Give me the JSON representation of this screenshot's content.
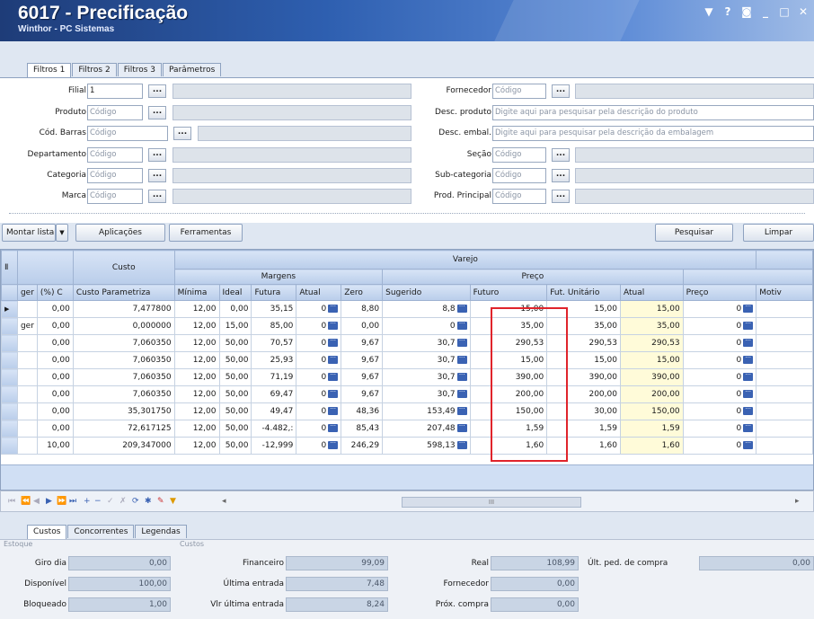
{
  "window": {
    "title": "6017 - Precificação",
    "subtitle": "Winthor - PC Sistemas",
    "controls": [
      "▼",
      "?",
      "◙",
      "_",
      "□",
      "✕"
    ]
  },
  "top_tabs": [
    "Filtros 1",
    "Filtros 2",
    "Filtros 3",
    "Parâmetros"
  ],
  "filters_left": [
    {
      "label": "Filial",
      "value": "1",
      "placeholder": ""
    },
    {
      "label": "Produto",
      "value": "",
      "placeholder": "Código"
    },
    {
      "label": "Cód. Barras",
      "value": "",
      "placeholder": "Código"
    },
    {
      "label": "Departamento",
      "value": "",
      "placeholder": "Código"
    },
    {
      "label": "Categoria",
      "value": "",
      "placeholder": "Código"
    },
    {
      "label": "Marca",
      "value": "",
      "placeholder": "Código"
    }
  ],
  "filters_right": [
    {
      "label": "Fornecedor",
      "placeholder": "Código"
    },
    {
      "label": "Desc. produto",
      "placeholder": "Digite aqui para pesquisar pela descrição do produto"
    },
    {
      "label": "Desc. embal.",
      "placeholder": "Digite aqui para pesquisar pela descrição da embalagem"
    },
    {
      "label": "Seção",
      "placeholder": "Código"
    },
    {
      "label": "Sub-categoria",
      "placeholder": "Código"
    },
    {
      "label": "Prod. Principal",
      "placeholder": "Código"
    }
  ],
  "dots_label": "...",
  "toolbar": {
    "montar_lista": "Montar lista",
    "aplicacoes": "Aplicações",
    "ferramentas": "Ferramentas",
    "pesquisar": "Pesquisar",
    "limpar": "Limpar"
  },
  "grid": {
    "group_custo": "Custo",
    "group_varejo": "Varejo",
    "group_margens": "Margens",
    "group_preco": "Preço",
    "columns": [
      "",
      "ger",
      "(%) C",
      "Custo Parametriza",
      "Mínima",
      "Ideal",
      "Futura",
      "Atual",
      "Zero",
      "Sugerido",
      "Futuro",
      "Fut. Unitário",
      "Atual",
      "Preço",
      "Motiv"
    ],
    "rows": [
      {
        "mark": "▶",
        "ger": "",
        "pc": "0,00",
        "custo": "7,477800",
        "min": "12,00",
        "ideal": "0,00",
        "futura": "35,15",
        "atual": "0",
        "zero": "8,80",
        "sug": "8,8",
        "futuro": "15,00",
        "futunit": "15,00",
        "patual": "15,00",
        "preco": "0"
      },
      {
        "mark": "",
        "ger": "ger",
        "pc": "0,00",
        "custo": "0,000000",
        "min": "12,00",
        "ideal": "15,00",
        "futura": "85,00",
        "atual": "0",
        "zero": "0,00",
        "sug": "0",
        "futuro": "35,00",
        "futunit": "35,00",
        "patual": "35,00",
        "preco": "0"
      },
      {
        "mark": "",
        "ger": "",
        "pc": "0,00",
        "custo": "7,060350",
        "min": "12,00",
        "ideal": "50,00",
        "futura": "70,57",
        "atual": "0",
        "zero": "9,67",
        "sug": "30,7",
        "futuro": "290,53",
        "futunit": "290,53",
        "patual": "290,53",
        "preco": "0"
      },
      {
        "mark": "",
        "ger": "",
        "pc": "0,00",
        "custo": "7,060350",
        "min": "12,00",
        "ideal": "50,00",
        "futura": "25,93",
        "atual": "0",
        "zero": "9,67",
        "sug": "30,7",
        "futuro": "15,00",
        "futunit": "15,00",
        "patual": "15,00",
        "preco": "0"
      },
      {
        "mark": "",
        "ger": "",
        "pc": "0,00",
        "custo": "7,060350",
        "min": "12,00",
        "ideal": "50,00",
        "futura": "71,19",
        "atual": "0",
        "zero": "9,67",
        "sug": "30,7",
        "futuro": "390,00",
        "futunit": "390,00",
        "patual": "390,00",
        "preco": "0"
      },
      {
        "mark": "",
        "ger": "",
        "pc": "0,00",
        "custo": "7,060350",
        "min": "12,00",
        "ideal": "50,00",
        "futura": "69,47",
        "atual": "0",
        "zero": "9,67",
        "sug": "30,7",
        "futuro": "200,00",
        "futunit": "200,00",
        "patual": "200,00",
        "preco": "0"
      },
      {
        "mark": "",
        "ger": "",
        "pc": "0,00",
        "custo": "35,301750",
        "min": "12,00",
        "ideal": "50,00",
        "futura": "49,47",
        "atual": "0",
        "zero": "48,36",
        "sug": "153,49",
        "futuro": "150,00",
        "futunit": "30,00",
        "patual": "150,00",
        "preco": "0"
      },
      {
        "mark": "",
        "ger": "",
        "pc": "0,00",
        "custo": "72,617125",
        "min": "12,00",
        "ideal": "50,00",
        "futura": "-4.482,:",
        "atual": "0",
        "zero": "85,43",
        "sug": "207,48",
        "futuro": "1,59",
        "futunit": "1,59",
        "patual": "1,59",
        "preco": "0"
      },
      {
        "mark": "",
        "ger": "",
        "pc": "10,00",
        "custo": "209,347000",
        "min": "12,00",
        "ideal": "50,00",
        "futura": "-12,999",
        "atual": "0",
        "zero": "246,29",
        "sug": "598,13",
        "futuro": "1,60",
        "futunit": "1,60",
        "patual": "1,60",
        "preco": "0"
      }
    ]
  },
  "bottom_tabs": [
    "Custos",
    "Concorrentes",
    "Legendas"
  ],
  "bottom": {
    "estoque_title": "Estoque",
    "custos_title": "Custos",
    "estoque": [
      {
        "label": "Giro dia",
        "value": "0,00"
      },
      {
        "label": "Disponível",
        "value": "100,00"
      },
      {
        "label": "Bloqueado",
        "value": "1,00"
      }
    ],
    "custos": [
      {
        "label": "Financeiro",
        "value": "99,09"
      },
      {
        "label": "Última entrada",
        "value": "7,48"
      },
      {
        "label": "Vlr última entrada",
        "value": "8,24"
      }
    ],
    "custos2": [
      {
        "label": "Real",
        "value": "108,99"
      },
      {
        "label": "Fornecedor",
        "value": "0,00"
      },
      {
        "label": "Próx. compra",
        "value": "0,00"
      }
    ],
    "ult_ped_label": "Últ. ped. de compra",
    "ult_ped_value": "0,00"
  },
  "scroll_center": "III"
}
